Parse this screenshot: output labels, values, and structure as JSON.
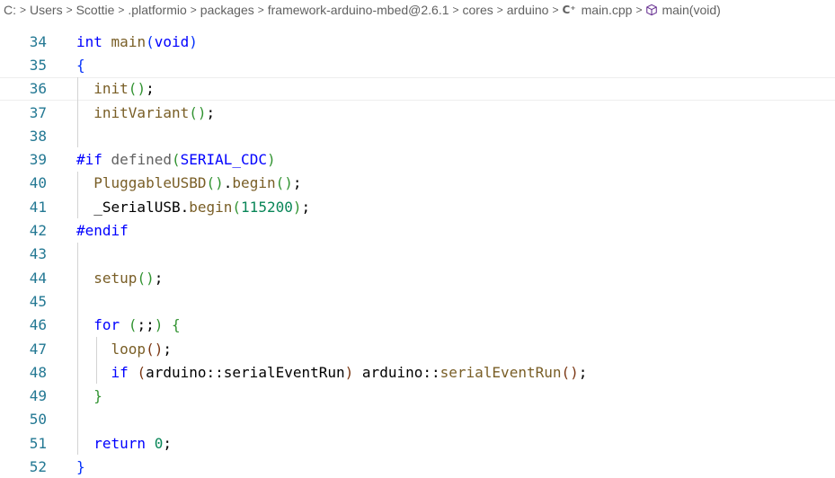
{
  "breadcrumb": {
    "items": [
      "C:",
      "Users",
      "Scottie",
      ".platformio",
      "packages",
      "framework-arduino-mbed@2.6.1",
      "cores",
      "arduino",
      "main.cpp",
      "main(void)"
    ],
    "separator": ">",
    "file_icon": "C⁺"
  },
  "editor": {
    "language": "cpp",
    "current_line": 36,
    "lines": [
      {
        "num": "34",
        "text": "int main(void)"
      },
      {
        "num": "35",
        "text": "{"
      },
      {
        "num": "36",
        "text": "  init();"
      },
      {
        "num": "37",
        "text": "  initVariant();"
      },
      {
        "num": "38",
        "text": ""
      },
      {
        "num": "39",
        "text": "#if defined(SERIAL_CDC)"
      },
      {
        "num": "40",
        "text": "  PluggableUSBD().begin();"
      },
      {
        "num": "41",
        "text": "  _SerialUSB.begin(115200);"
      },
      {
        "num": "42",
        "text": "#endif"
      },
      {
        "num": "43",
        "text": ""
      },
      {
        "num": "44",
        "text": "  setup();"
      },
      {
        "num": "45",
        "text": ""
      },
      {
        "num": "46",
        "text": "  for (;;) {"
      },
      {
        "num": "47",
        "text": "    loop();"
      },
      {
        "num": "48",
        "text": "    if (arduino::serialEventRun) arduino::serialEventRun();"
      },
      {
        "num": "49",
        "text": "  }"
      },
      {
        "num": "50",
        "text": ""
      },
      {
        "num": "51",
        "text": "  return 0;"
      },
      {
        "num": "52",
        "text": "}"
      }
    ]
  },
  "colors": {
    "line_number": "#237893",
    "keyword": "#0000ff",
    "function": "#795e26",
    "number": "#098658",
    "type_namespace": "#267f99",
    "bracket_level1": "#0431fa",
    "bracket_level2": "#319331",
    "bracket_level3": "#7b3814",
    "breadcrumb_text": "#616161",
    "file_icon": "#a074c4"
  },
  "icons": {
    "file": "cpp-file-icon",
    "symbol": "method-cube-icon",
    "separator": "chevron-right-icon"
  }
}
